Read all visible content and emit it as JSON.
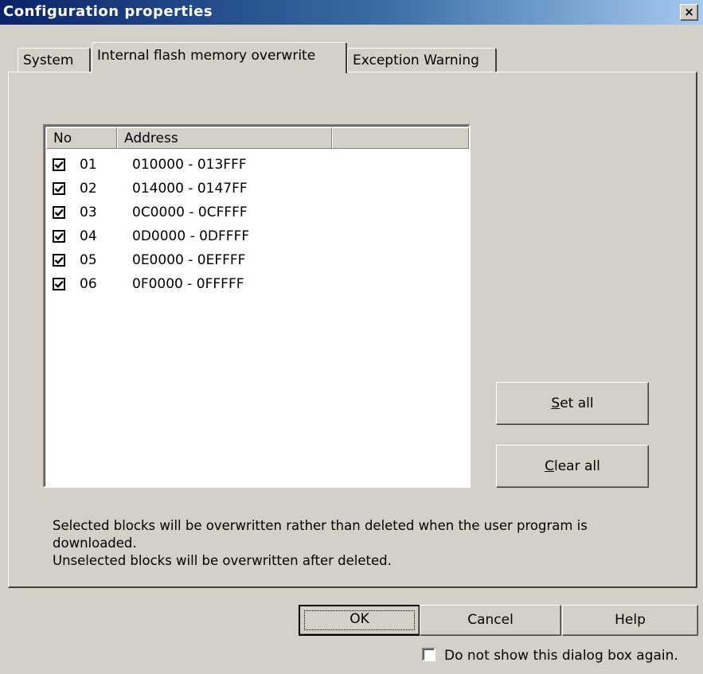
{
  "window": {
    "title": "Configuration properties",
    "close_symbol": "×"
  },
  "tabs": [
    {
      "label": "System"
    },
    {
      "label": "Internal flash memory overwrite",
      "active": true
    },
    {
      "label": "Exception Warning"
    }
  ],
  "table": {
    "columns": [
      "No",
      "Address",
      ""
    ],
    "rows": [
      {
        "no": "01",
        "address": "010000 - 013FFF",
        "checked": true
      },
      {
        "no": "02",
        "address": "014000 - 0147FF",
        "checked": true
      },
      {
        "no": "03",
        "address": "0C0000 - 0CFFFF",
        "checked": true
      },
      {
        "no": "04",
        "address": "0D0000 - 0DFFFF",
        "checked": true
      },
      {
        "no": "05",
        "address": "0E0000 - 0EFFFF",
        "checked": true
      },
      {
        "no": "06",
        "address": "0F0000 - 0FFFFF",
        "checked": true
      }
    ]
  },
  "actions": {
    "set_all": {
      "mnemonic": "S",
      "rest": "et all"
    },
    "clear_all": {
      "mnemonic": "C",
      "rest": "lear all"
    }
  },
  "message": {
    "line1": "Selected blocks will be overwritten rather than deleted when the user program is downloaded.",
    "line2": "Unselected blocks will be overwritten after deleted."
  },
  "footer": {
    "ok": "OK",
    "cancel": "Cancel",
    "help": "Help",
    "dont_show": {
      "label": "Do not show this dialog box again.",
      "checked": false
    }
  }
}
